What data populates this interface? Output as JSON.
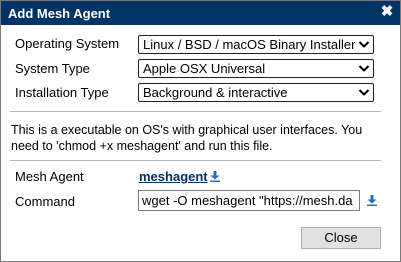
{
  "dialog": {
    "title": "Add Mesh Agent",
    "close_glyph": "✖"
  },
  "form": {
    "os_label": "Operating System",
    "os_value": "Linux / BSD / macOS Binary Installer",
    "type_label": "System Type",
    "type_value": "Apple OSX Universal",
    "install_label": "Installation Type",
    "install_value": "Background & interactive"
  },
  "description": "This is a executable on OS's with graphical user interfaces. You need to 'chmod +x meshagent' and run this file.",
  "agent": {
    "label": "Mesh Agent",
    "link_text": "meshagent"
  },
  "command": {
    "label": "Command",
    "value": "wget -O meshagent \"https://mesh.da"
  },
  "buttons": {
    "close_label": "Close"
  },
  "colors": {
    "titlebar": "#003366",
    "link": "#003366",
    "download_icon": "#2a6fb5"
  },
  "icons": [
    "close-icon",
    "chevron-down-icon",
    "download-icon"
  ]
}
